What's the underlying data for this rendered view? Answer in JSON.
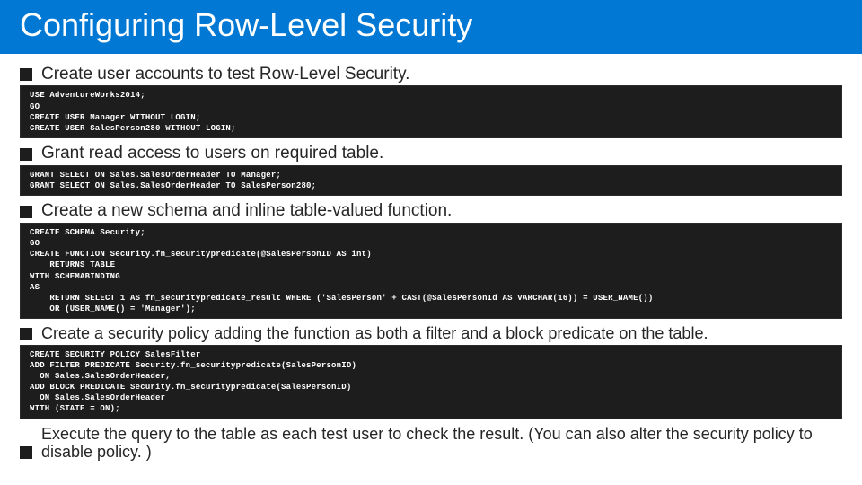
{
  "title": "Configuring Row-Level Security",
  "sections": [
    {
      "label": "Create user accounts to test Row-Level Security.",
      "code": "USE AdventureWorks2014;\nGO\nCREATE USER Manager WITHOUT LOGIN;\nCREATE USER SalesPerson280 WITHOUT LOGIN;"
    },
    {
      "label": "Grant read access to users on required table.",
      "code": "GRANT SELECT ON Sales.SalesOrderHeader TO Manager;\nGRANT SELECT ON Sales.SalesOrderHeader TO SalesPerson280;"
    },
    {
      "label": "Create a new schema and inline table-valued function.",
      "code": "CREATE SCHEMA Security;\nGO\nCREATE FUNCTION Security.fn_securitypredicate(@SalesPersonID AS int)\n    RETURNS TABLE\nWITH SCHEMABINDING\nAS\n    RETURN SELECT 1 AS fn_securitypredicate_result WHERE ('SalesPerson' + CAST(@SalesPersonId AS VARCHAR(16)) = USER_NAME())\n    OR (USER_NAME() = 'Manager');"
    },
    {
      "label": "Create a security policy adding the function as both a filter and a block predicate on the table.",
      "code": "CREATE SECURITY POLICY SalesFilter\nADD FILTER PREDICATE Security.fn_securitypredicate(SalesPersonID)\n  ON Sales.SalesOrderHeader,\nADD BLOCK PREDICATE Security.fn_securitypredicate(SalesPersonID)\n  ON Sales.SalesOrderHeader\nWITH (STATE = ON);"
    },
    {
      "label": "Execute the query to the table as each test user to check the result. (You can also alter the security policy to disable policy. )",
      "code": null
    }
  ]
}
